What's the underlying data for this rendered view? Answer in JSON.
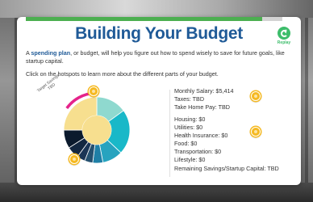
{
  "page": {
    "title": "Building Your Budget",
    "replay_label": "Replay",
    "progress_percent": 92
  },
  "intro": {
    "prefix": "A ",
    "keyword": "spending plan",
    "suffix": ", or budget, will help you figure out how to spend wisely to save for future goals, like startup capital.",
    "instruction": "Click on the hotspots to learn more about the different parts of your budget."
  },
  "chart": {
    "target_label_line1": "Target Savings:",
    "target_label_line2": "TBD"
  },
  "income": {
    "monthly_salary": "Monthly Salary: $5,414",
    "taxes": "Taxes: TBD",
    "take_home": "Take Home Pay: TBD"
  },
  "expenses": {
    "housing": "Housing: $0",
    "utilities": "Utilities: $0",
    "health_insurance": "Health Insurance: $0",
    "food": "Food: $0",
    "transportation": "Transportation: $0",
    "lifestyle": "Lifestyle: $0"
  },
  "remaining": {
    "label": "Remaining Savings/Startup Capital: TBD"
  },
  "colors": {
    "title": "#1f5a97",
    "progress": "#4caf50",
    "hotspot": "#f5b921",
    "replay": "#3dbd6b",
    "target_arc": "#e5238a"
  },
  "chart_data": {
    "type": "pie",
    "slices": [
      {
        "name": "segment-1",
        "value": 15,
        "color": "#8fd9cf"
      },
      {
        "name": "segment-2",
        "value": 22,
        "color": "#19b8c8"
      },
      {
        "name": "segment-3",
        "value": 10,
        "color": "#27a3bf"
      },
      {
        "name": "segment-4",
        "value": 5,
        "color": "#1f7fa6"
      },
      {
        "name": "segment-5",
        "value": 4,
        "color": "#25506f"
      },
      {
        "name": "segment-6",
        "value": 4,
        "color": "#1b3555"
      },
      {
        "name": "segment-7",
        "value": 6,
        "color": "#132740"
      },
      {
        "name": "segment-8",
        "value": 9,
        "color": "#0b1a2d"
      },
      {
        "name": "segment-9",
        "value": 25,
        "color": "#f7df8f"
      }
    ]
  }
}
